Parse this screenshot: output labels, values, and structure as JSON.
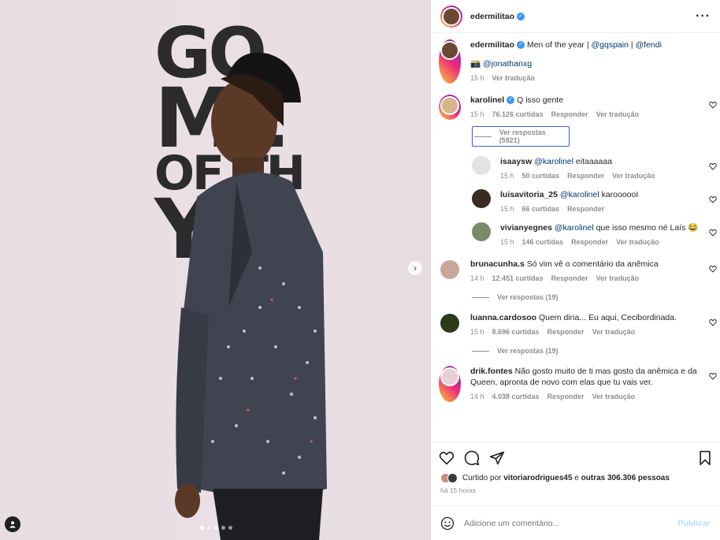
{
  "post": {
    "author": "edermilitao",
    "caption_text": "Men of the year |",
    "caption_mentions": [
      "@gqspain",
      "@fendi"
    ],
    "caption_sep": "|",
    "caption_line2_mention": "@jonathanxg",
    "caption_time": "15 h",
    "caption_translate": "Ver tradução"
  },
  "photo": {
    "sign_line1": "GQ",
    "sign_line2": "ME",
    "sign_line3": "OF TH",
    "sign_line4": "YE",
    "carousel_count": 5,
    "carousel_active": 1
  },
  "comments": [
    {
      "user": "karolinel",
      "verified": true,
      "text": "Q isso gente",
      "time": "15 h",
      "likes": "76.126 curtidas",
      "reply": "Responder",
      "translate": "Ver tradução",
      "avatar_color": "#d7b48a",
      "view_replies": "Ver respostas (5921)",
      "replies": [
        {
          "user": "isaaysw",
          "mention": "@karolinel",
          "text": "eitaaaaaa",
          "time": "15 h",
          "likes": "50 curtidas",
          "reply": "Responder",
          "translate": "Ver tradução",
          "avatar_color": "#e3e3e3"
        },
        {
          "user": "luisavitoria_25",
          "mention": "@karolinel",
          "text": "karoooooI",
          "time": "15 h",
          "likes": "66 curtidas",
          "reply": "Responder",
          "translate": "",
          "avatar_color": "#3a2a22"
        },
        {
          "user": "vivianyegnes",
          "mention": "@karolinel",
          "text": "que isso mesmo né Laís",
          "emoji": "😂",
          "time": "15 h",
          "likes": "146 curtidas",
          "reply": "Responder",
          "translate": "Ver tradução",
          "avatar_color": "#7c8a6a"
        }
      ]
    },
    {
      "user": "brunacunha.s",
      "text": "Só vim vê o comentário da anêmica",
      "time": "14 h",
      "likes": "12.451 curtidas",
      "reply": "Responder",
      "translate": "Ver tradução",
      "avatar_color": "#c9a79a",
      "view_replies": "Ver respostas (19)"
    },
    {
      "user": "luanna.cardosoo",
      "text": "Quem diria... Eu aqui, Cecibordinada.",
      "time": "15 h",
      "likes": "8.696 curtidas",
      "reply": "Responder",
      "translate": "Ver tradução",
      "avatar_color": "#2d3a1a",
      "view_replies": "Ver respostas (19)"
    },
    {
      "user": "drik.fontes",
      "text": "Não gosto muito de ti mas gosto da anêmica e da Queen, apronta de novo com elas que tu vais ver.",
      "time": "14 h",
      "likes": "4.038 curtidas",
      "reply": "Responder",
      "translate": "Ver tradução",
      "avatar_color": "#e8cfd6"
    }
  ],
  "footer": {
    "liked_prefix": "Curtido por",
    "liked_user": "vitoriarodrigues45",
    "liked_and": "e",
    "liked_others": "outras 306.306 pessoas",
    "timestamp": "há 15 horas",
    "add_comment_placeholder": "Adicione um comentário...",
    "publish": "Publicar"
  },
  "icons": {
    "more": "more-icon",
    "heart": "heart-icon",
    "comment": "comment-icon",
    "share": "share-icon",
    "save": "bookmark-icon",
    "emoji": "emoji-icon",
    "next": "chevron-right-icon",
    "user_tag": "user-tag-icon"
  },
  "colors": {
    "verified": "#3897f0",
    "mention": "#00376b",
    "muted": "#8e8e8e",
    "publish_disabled": "#b2dffc"
  }
}
